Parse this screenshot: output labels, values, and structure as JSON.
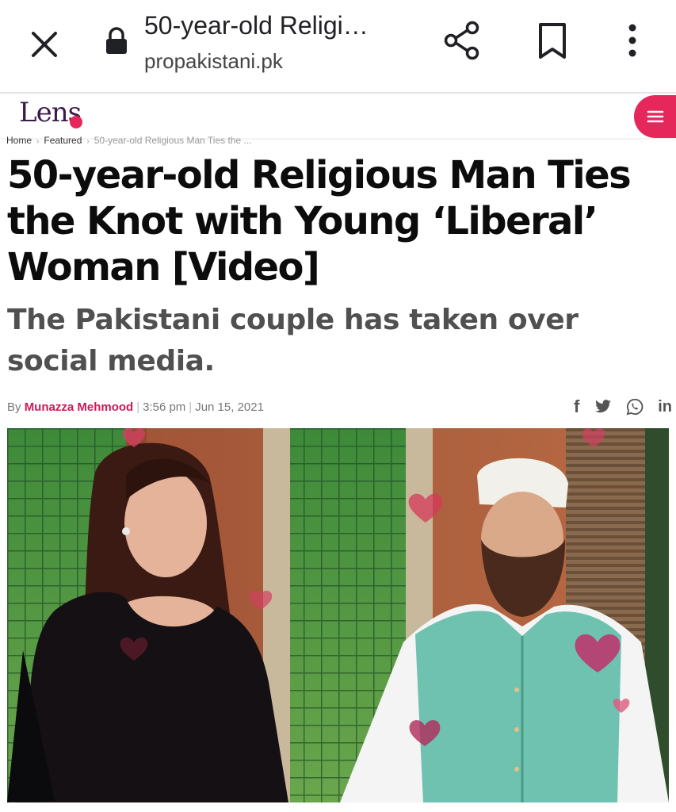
{
  "browser": {
    "tab_title": "50-year-old Religi…",
    "domain": "propakistani.pk",
    "icons": [
      "close-icon",
      "lock-icon",
      "share-icon",
      "bookmark-icon",
      "more-vert-icon"
    ]
  },
  "site": {
    "logo_text": "Lens",
    "menu_icon": "hamburger-icon",
    "accent_color": "#e6275b"
  },
  "breadcrumb": {
    "items": [
      "Home",
      "Featured",
      "50-year-old Religious Man Ties the ..."
    ]
  },
  "article": {
    "title": "50-year-old Religious Man Ties the Knot with Young ‘Liberal’ Woman [Video]",
    "subtitle": "The Pakistani couple has taken over social media.",
    "byline_prefix": "By",
    "author": "Munazza Mehmood",
    "time": "3:56 pm",
    "date": "Jun 15, 2021",
    "share_icons": [
      "facebook-icon",
      "twitter-icon",
      "whatsapp-icon",
      "linkedin-icon"
    ],
    "share_labels": [
      "f",
      "in"
    ]
  }
}
